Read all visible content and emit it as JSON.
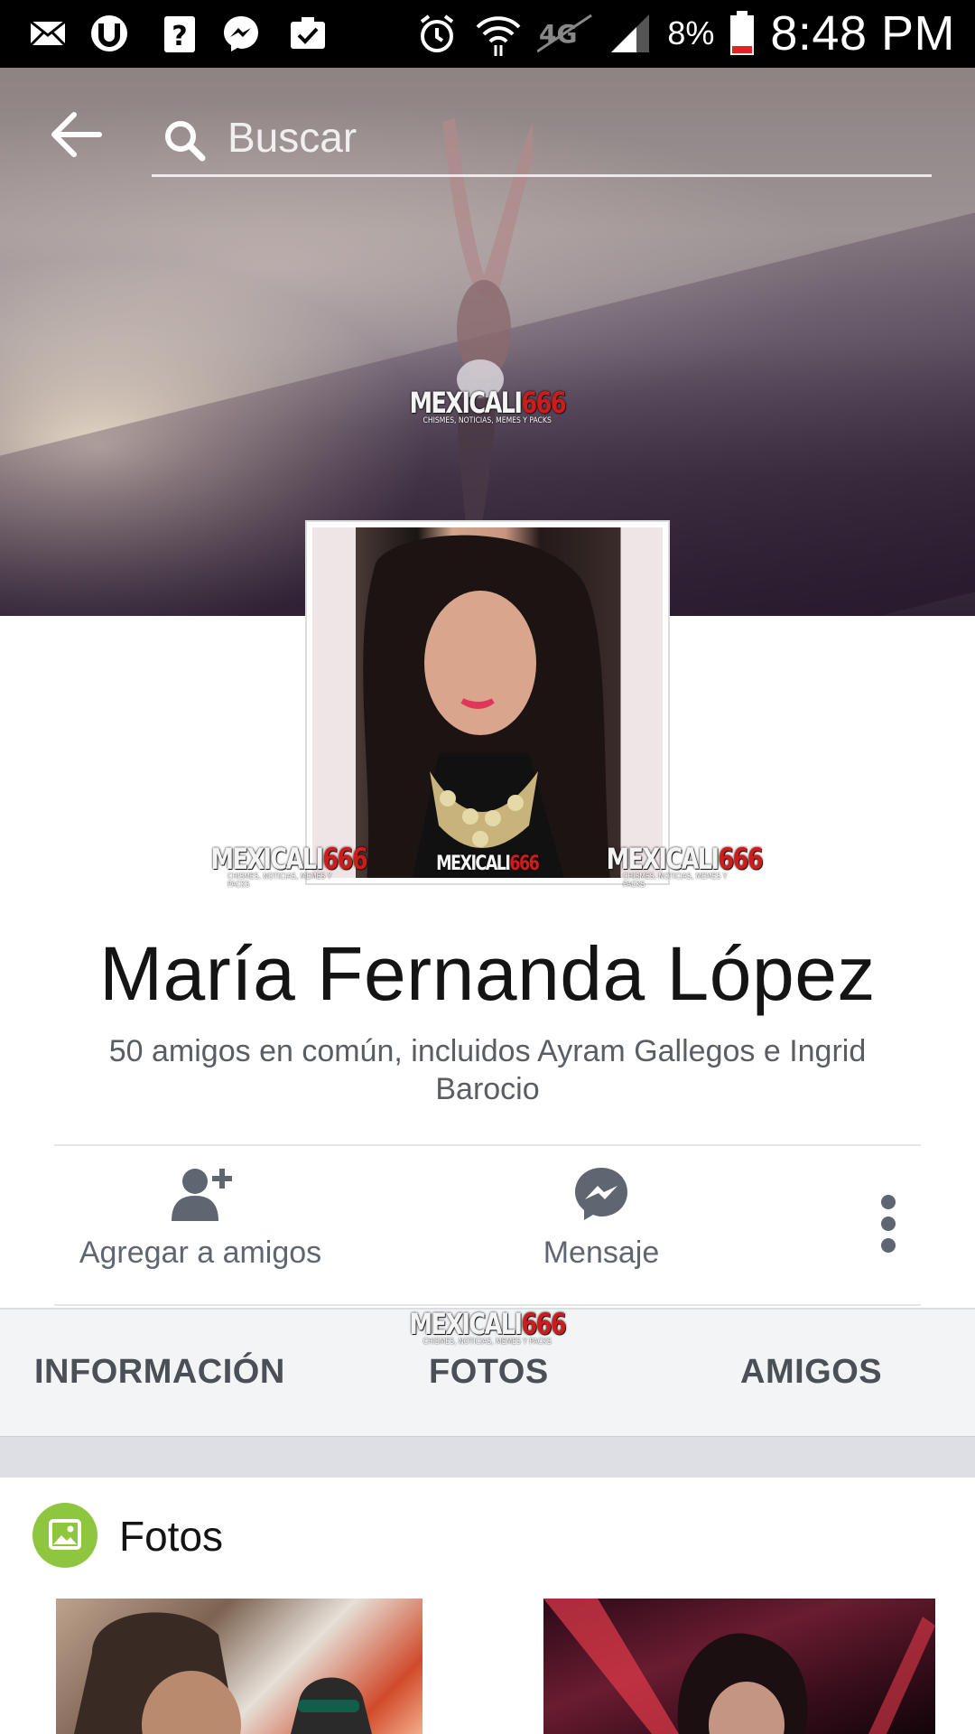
{
  "status_bar": {
    "battery_percent": "8%",
    "time": "8:48 PM"
  },
  "search": {
    "placeholder": "Buscar"
  },
  "watermark": {
    "brand_main": "MEXICALI",
    "brand_number": "666",
    "tagline": "CHISMES, NOTICIAS, MEMES Y PACKS"
  },
  "profile": {
    "name": "María Fernanda López",
    "mutual_friends": "50 amigos en común, incluidos Ayram Gallegos e Ingrid Barocio"
  },
  "actions": {
    "add_friend": "Agregar a amigos",
    "message": "Mensaje"
  },
  "tabs": {
    "info": "INFORMACIÓN",
    "photos": "FOTOS",
    "friends": "AMIGOS"
  },
  "photos_section": {
    "title": "Fotos"
  },
  "colors": {
    "status_bar_bg": "#000000",
    "accent_green": "#8ec63f",
    "action_gray": "#5f6672",
    "tab_bg": "#f3f4f6",
    "watermark_red": "#d11a1a"
  }
}
